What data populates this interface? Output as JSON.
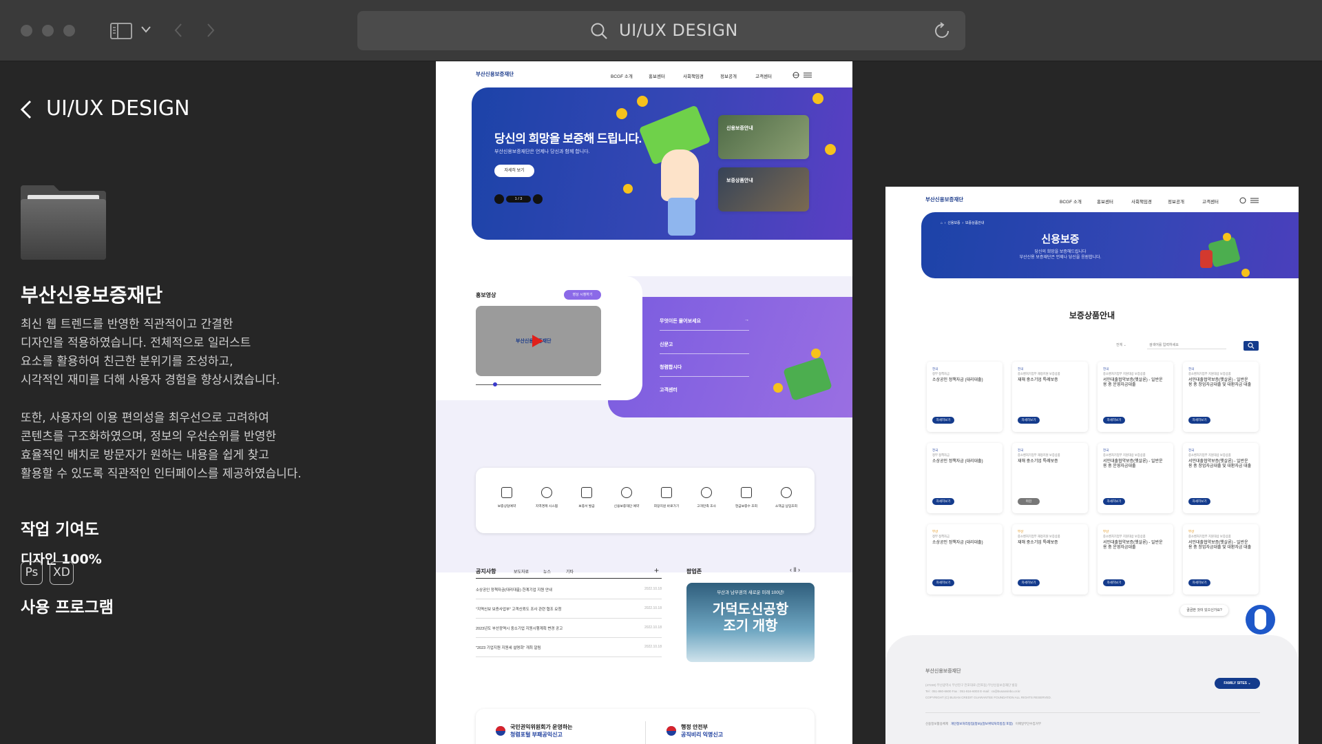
{
  "window": {
    "search_text": "UI/UX DESIGN"
  },
  "sidebar": {
    "back_title": "UI/UX DESIGN",
    "project_name": "부산신용보증재단",
    "desc1": [
      "최신 웹 트렌드를 반영한 직관적이고 간결한",
      "디자인을 적용하였습니다. 전체적으로 일러스트",
      "요소를 활용하여 친근한 분위기를 조성하고,",
      "시각적인 재미를 더해 사용자 경험을 향상시켰습니다."
    ],
    "desc2": [
      "또한, 사용자의 이용 편의성을 최우선으로 고려하여",
      "콘텐츠를 구조화하였으며, 정보의 우선순위를 반영한",
      "효율적인 배치로 방문자가 원하는 내용을 쉽게 찾고",
      "활용할 수 있도록 직관적인 인터페이스를 제공하였습니다."
    ],
    "contribution_title": "작업 기여도",
    "contribution_value": "디자인 100%",
    "program_title": "사용 프로그램",
    "programs": [
      "Ps",
      "XD"
    ]
  },
  "mock1": {
    "logo": "부산신용보증재단",
    "nav": [
      "BCGF 소개",
      "홍보센터",
      "사회책임경",
      "정보공개",
      "고객센터"
    ],
    "hero_title": "당신의 희망을 보증해 드립니다.",
    "hero_sub": "부산신용보증재단은 언제나 당신과 함께 합니다.",
    "hero_btn": "자세히 보기",
    "slide": "1 / 3",
    "hero_card1": "신용보증안내",
    "hero_card2": "보증상품안내",
    "promo_title": "홍보영상",
    "promo_btn": "영상 시청하기",
    "video_logo": "부산신용보증재단",
    "quick_links": [
      "무엇이든 물어보세요",
      "신문고",
      "청렴합시다",
      "고객센터"
    ],
    "services": [
      "보증상담예약",
      "지역경제 시스템",
      "보증서 발급",
      "신용보증재단 예약",
      "희망지원 바로가기",
      "고객만족 조사",
      "현금보증수 조회",
      "소액금 납입조회"
    ],
    "notice_tabs": [
      "공지사항",
      "보도자료",
      "뉴스",
      "기타"
    ],
    "notice_plus": "+",
    "notices": [
      {
        "title": "소상공인 정책자금(대리대출) 한계기업 지원 안내",
        "date": "2022.10.18"
      },
      {
        "title": "\"지역신보 보증사업부\" 고객신뢰도 조사 관련 협조 요청",
        "date": "2022.10.18"
      },
      {
        "title": "2023년도 부산광역시 중소기업 지원시행계획 변경 공고",
        "date": "2022.10.18"
      },
      {
        "title": "\"2023 기업지원 지원세 설명회\" 개최 알림",
        "date": "2022.10.18"
      }
    ],
    "banner_title": "팝업존",
    "banner_top": "부산과 남부권의 새로운 미래 100년!",
    "banner_main1": "가덕도신공항",
    "banner_main2": "조기 개항",
    "footer_left1": "국민권익위원회가 운영하는",
    "footer_left2": "청렴포털 부패공익신고",
    "footer_right1": "행정 안전부",
    "footer_right2": "공직비리 익명신고"
  },
  "mock2": {
    "logo": "부산신용보증재단",
    "nav": [
      "BCGF 소개",
      "홍보센터",
      "사회책임경",
      "정보공개",
      "고객센터"
    ],
    "breadcrumb": [
      "신용보증",
      "보증상품안내"
    ],
    "hero_title": "신용보증",
    "hero_sub1": "당신의 희망을 보증해드립니다",
    "hero_sub2": "부산신용 보증재단은 언제나 당신을 응원합니다.",
    "section_title": "보증상품안내",
    "search_select": "전체",
    "search_placeholder": "검색어를 입력하세요",
    "products": [
      {
        "tag": "전국",
        "cat": "정부 정책자금",
        "title": "소상공인 정책자금 (대리대출)",
        "btn": "자세히보기"
      },
      {
        "tag": "전국",
        "cat": "중소벤처기업부 재정지원 보증상품",
        "title": "재해 중소기업 특례보증",
        "btn": "자세히보기"
      },
      {
        "tag": "전국",
        "cat": "중소벤처기업부 지원대상 보증상품",
        "title": "서민대출협약보증(햇살론) - 일반운용 중 운영자금대출",
        "btn": "자세히보기"
      },
      {
        "tag": "전국",
        "cat": "중소벤처기업부 지원대상 보증상품",
        "title": "서민대출협약보증(햇살론) - 일반운용 중 창업자금대출 및 대환자금 대출",
        "btn": "자세히보기"
      },
      {
        "tag": "전국",
        "cat": "정부 정책자금",
        "title": "소상공인 정책자금 (대리대출)",
        "btn": "자세히보기"
      },
      {
        "tag": "전국",
        "cat": "중소벤처기업부 재정지원 보증상품",
        "title": "재해 중소기업 특례보증",
        "btn": "마감"
      },
      {
        "tag": "전국",
        "cat": "중소벤처기업부 지원대상 보증상품",
        "title": "서민대출협약보증(햇살론) - 일반운용 중 운영자금대출",
        "btn": "자세히보기"
      },
      {
        "tag": "전국",
        "cat": "중소벤처기업부 지원대상 보증상품",
        "title": "서민대출협약보증(햇살론) - 일반운용 중 창업자금대출 및 대환자금 대출",
        "btn": "자세히보기"
      },
      {
        "tag": "부산",
        "cat": "정부 정책자금",
        "title": "소상공인 정책자금 (대리대출)",
        "btn": "자세히보기"
      },
      {
        "tag": "부산",
        "cat": "중소벤처기업부 재정지원 보증상품",
        "title": "재해 중소기업 특례보증",
        "btn": "자세히보기"
      },
      {
        "tag": "부산",
        "cat": "중소벤처기업부 지원대상 보증상품",
        "title": "서민대출협약보증(햇살론) - 일반운용 중 운영자금대출",
        "btn": "자세히보기"
      },
      {
        "tag": "부산",
        "cat": "중소벤처기업부 지원대상 보증상품",
        "title": "서민대출협약보증(햇살론) - 일반운용 중 창업자금대출 및 대환자금 대출",
        "btn": "자세히보기"
      }
    ],
    "chat_label": "궁금한 것이 있으신가요?",
    "footer_logo": "부산신용보증재단",
    "footer_addr": "(47230) 부산광역시 부산진구 전포대로 (전포동) 부산신용보증재단 빌딩",
    "footer_tel": "Tel : 051-860-6600  Fax : 051-816-6003  E-mail : cs@busansinbo.or.kr",
    "footer_copy": "COPYRIGHT (C) BUSAN CREDIT GUARANTEE FOUNDATION ALL RIGHTS RESERVED.",
    "family_sites": "FAMILY SITES",
    "footer_links": [
      "신용정보활용체제",
      "개인정보처리방침(정보)(정보위탁처리방침 포함)",
      "이메일무단수집거부"
    ]
  },
  "colors": {
    "navy": "#143b8c",
    "purple": "#6b4fd8",
    "violet": "#8b6ae8"
  }
}
